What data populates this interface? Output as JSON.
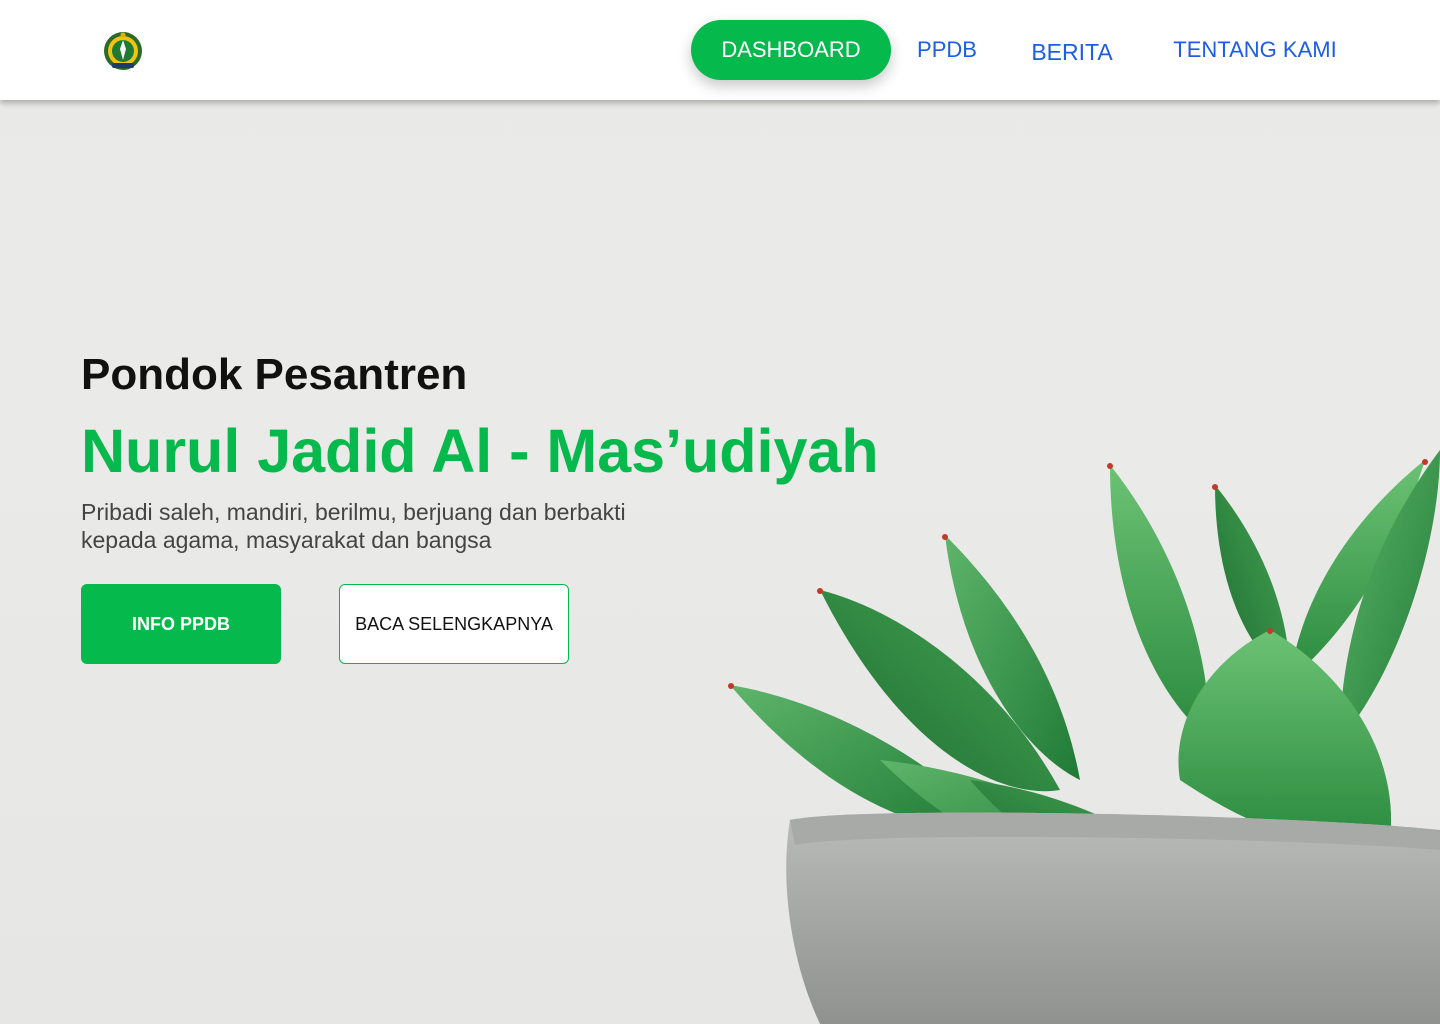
{
  "header": {
    "logo_icon": "school-crest-logo",
    "nav": {
      "dashboard": "DASHBOARD",
      "ppdb": "PPDB",
      "berita": "BERITA",
      "tentang": "TENTANG KAMI"
    }
  },
  "hero": {
    "subtitle": "Pondok Pesantren",
    "title": "Nurul Jadid Al - Mas’udiyah",
    "tagline": "Pribadi saleh, mandiri, berilmu, berjuang dan berbakti kepada agama, masyarakat dan bangsa",
    "primary_button": "INFO PPDB",
    "secondary_button": "BACA SELENGKAPNYA",
    "image": "succulent-plant-in-concrete-pot"
  },
  "colors": {
    "accent_green": "#05b94c",
    "nav_blue": "#1c5ee6",
    "background": "#e9e9e7"
  }
}
